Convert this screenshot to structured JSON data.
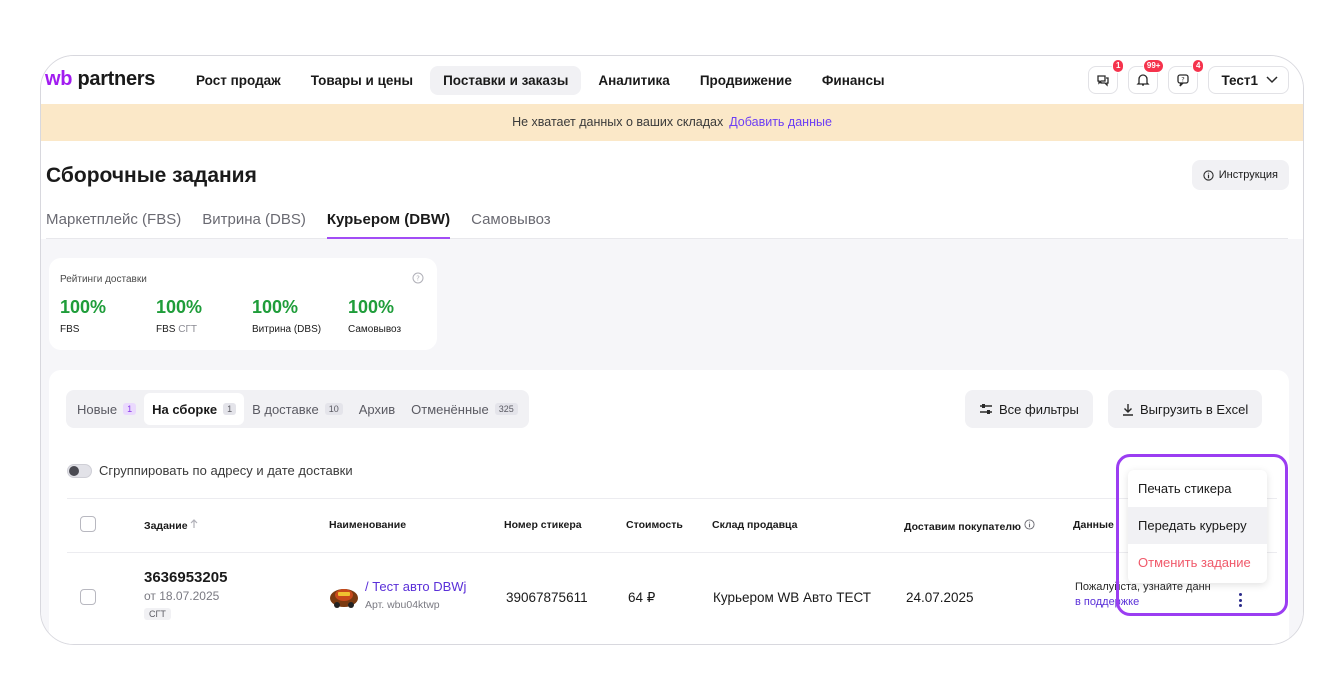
{
  "logo": {
    "wb": "wb",
    "partners": "partners"
  },
  "nav": [
    "Рост продаж",
    "Товары и цены",
    "Поставки и заказы",
    "Аналитика",
    "Продвижение",
    "Финансы"
  ],
  "nav_active_index": 2,
  "header_icons": [
    {
      "icon": "chat-icon",
      "badge": "1"
    },
    {
      "icon": "bell-icon",
      "badge": "99+"
    },
    {
      "icon": "help-chat-icon",
      "badge": "4"
    }
  ],
  "user": {
    "name": "Тест1"
  },
  "banner": {
    "text": "Не хватает данных о ваших складах",
    "link": "Добавить данные"
  },
  "page_title": "Сборочные задания",
  "instruction_label": "Инструкция",
  "tabs": [
    "Маркетплейс (FBS)",
    "Витрина (DBS)",
    "Курьером (DBW)",
    "Самовывоз"
  ],
  "tabs_active_index": 2,
  "ratings": {
    "title": "Рейтинги доставки",
    "items": [
      {
        "value": "100%",
        "label": "FBS",
        "suffix": ""
      },
      {
        "value": "100%",
        "label": "FBS",
        "suffix": "СГТ"
      },
      {
        "value": "100%",
        "label": "Витрина (DBS)",
        "suffix": ""
      },
      {
        "value": "100%",
        "label": "Самовывоз",
        "suffix": ""
      }
    ]
  },
  "subtabs": [
    {
      "label": "Новые",
      "count": "1"
    },
    {
      "label": "На сборке",
      "count": "1"
    },
    {
      "label": "В доставке",
      "count": "10"
    },
    {
      "label": "Архив",
      "count": ""
    },
    {
      "label": "Отменённые",
      "count": "325"
    }
  ],
  "filters_label": "Все фильтры",
  "excel_label": "Выгрузить в Excel",
  "group_toggle_label": "Сгруппировать по адресу и дате доставки",
  "columns": [
    "Задание",
    "Наименование",
    "Номер стикера",
    "Стоимость",
    "Склад продавца",
    "Доставим покупателю",
    "Данные"
  ],
  "row": {
    "task_id": "3636953205",
    "date": "от 18.07.2025",
    "tag": "СГТ",
    "product_name": "/ Тест авто DBWj",
    "article": "Арт. wbu04ktwp",
    "sticker": "39067875611",
    "price": "64 ₽",
    "warehouse": "Курьером WB Авто ТЕСТ",
    "delivery_date": "24.07.2025",
    "data_text": "Пожалуйста, узнайте данн",
    "data_link": "в поддержке"
  },
  "menu": [
    "Печать стикера",
    "Передать курьеру",
    "Отменить задание"
  ],
  "colors": {
    "accent": "#a21cf0",
    "highlight": "#9b3df2",
    "green": "#1f9d3a",
    "danger": "#f0596a",
    "banner": "#fbe8c8"
  }
}
